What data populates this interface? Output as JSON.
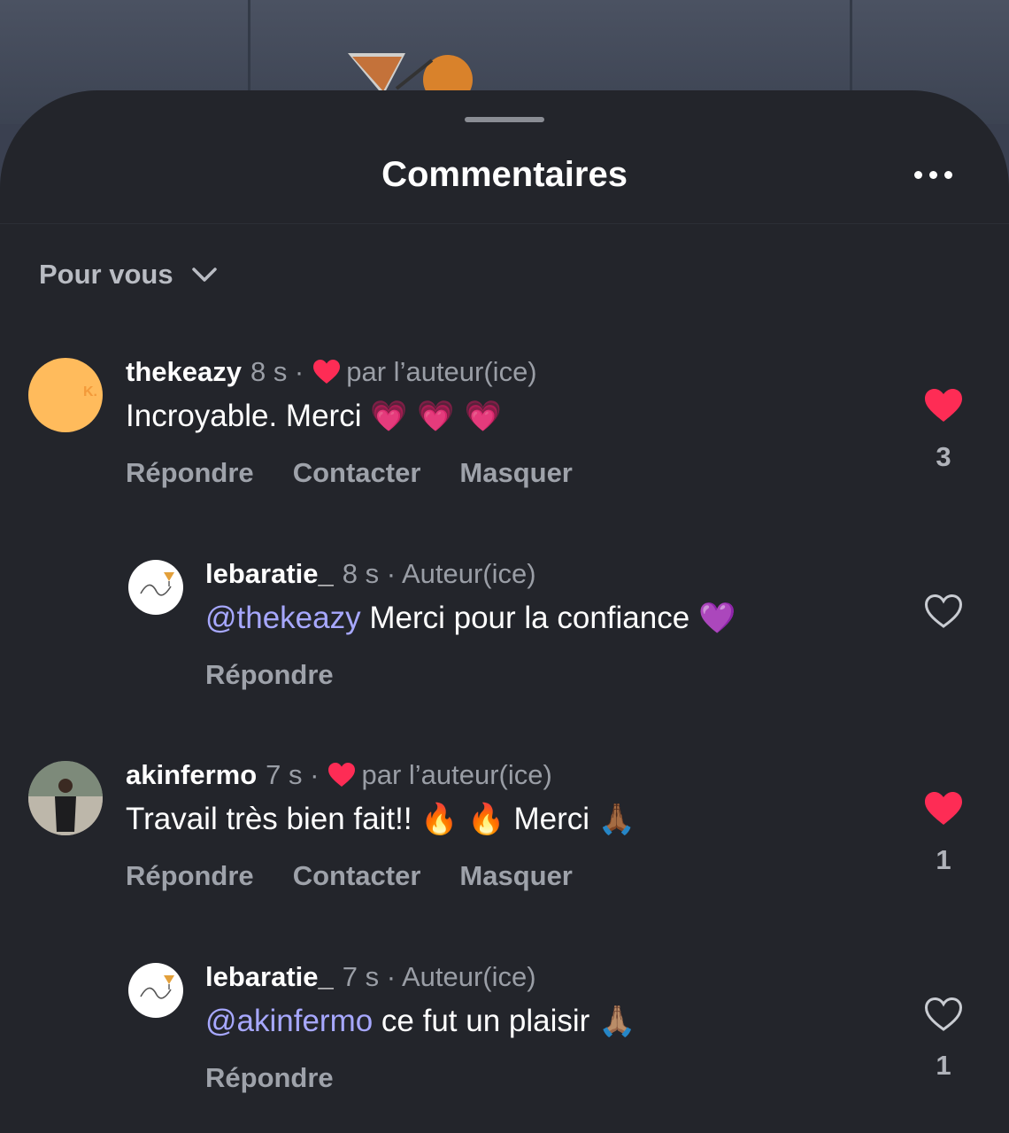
{
  "sheet": {
    "title": "Commentaires",
    "filter_label": "Pour vous"
  },
  "comments": [
    {
      "username": "thekeazy",
      "time": "8 s ·",
      "badge": "par l’auteur(ice)",
      "text": "Incroyable. Merci",
      "emoji": "💗 💗 💗",
      "actions": [
        "Répondre",
        "Contacter",
        "Masquer"
      ],
      "liked": true,
      "like_count": "3",
      "avatar_initial": "K."
    },
    {
      "username": "lebaratie_",
      "time": "8 s · Auteur(ice)",
      "mention": "@thekeazy",
      "text": " Merci pour la confiance",
      "emoji": "💜",
      "actions": [
        "Répondre"
      ],
      "liked": false,
      "like_count": ""
    },
    {
      "username": "akinfermo",
      "time": "7 s ·",
      "badge": "par l’auteur(ice)",
      "text": "Travail très bien fait!!",
      "emoji": "🔥 🔥",
      "text2": " Merci ",
      "emoji2": "🙏🏾",
      "actions": [
        "Répondre",
        "Contacter",
        "Masquer"
      ],
      "liked": true,
      "like_count": "1"
    },
    {
      "username": "lebaratie_",
      "time": "7 s · Auteur(ice)",
      "mention": "@akinfermo",
      "text": " ce fut un plaisir ",
      "emoji": "🙏🏽",
      "actions": [
        "Répondre"
      ],
      "liked": false,
      "like_count": "1"
    }
  ],
  "colors": {
    "sheet_bg": "#23252b",
    "like_red": "#fe2c55",
    "mention": "#a7a8ff",
    "avatar_yellow": "#ffbb5c"
  }
}
